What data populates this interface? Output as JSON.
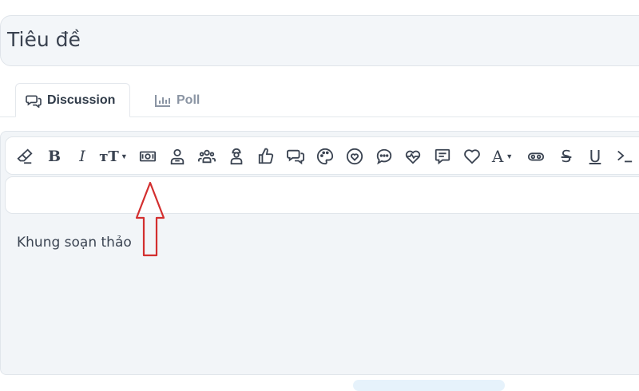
{
  "title": {
    "placeholder": "Tiêu đề"
  },
  "tabs": [
    {
      "label": "Discussion",
      "icon": "chat-bubbles-icon",
      "active": true
    },
    {
      "label": "Poll",
      "icon": "bar-chart-icon",
      "active": false
    }
  ],
  "toolbar": {
    "buttons": [
      {
        "name": "eraser-icon"
      },
      {
        "name": "bold-icon",
        "glyph": "B"
      },
      {
        "name": "italic-icon",
        "glyph": "I"
      },
      {
        "name": "font-size-icon",
        "glyph": "тT"
      },
      {
        "name": "money-icon"
      },
      {
        "name": "user-icon"
      },
      {
        "name": "group-icon"
      },
      {
        "name": "user-badge-icon"
      },
      {
        "name": "thumbs-up-icon"
      },
      {
        "name": "chat-bubbles-icon"
      },
      {
        "name": "palette-icon"
      },
      {
        "name": "heart-circle-icon"
      },
      {
        "name": "comment-dots-icon"
      },
      {
        "name": "heartbeat-icon"
      },
      {
        "name": "comment-lines-icon"
      },
      {
        "name": "heart-icon"
      },
      {
        "name": "text-color-icon",
        "glyph": "A"
      },
      {
        "name": "glasses-icon"
      },
      {
        "name": "strikethrough-icon",
        "glyph": "S"
      },
      {
        "name": "underline-icon",
        "glyph": "U"
      },
      {
        "name": "code-icon"
      }
    ]
  },
  "editor": {
    "placeholder": "Khung soạn thảo"
  },
  "annotation": {
    "color": "#d32f2f",
    "type": "up-arrow"
  }
}
